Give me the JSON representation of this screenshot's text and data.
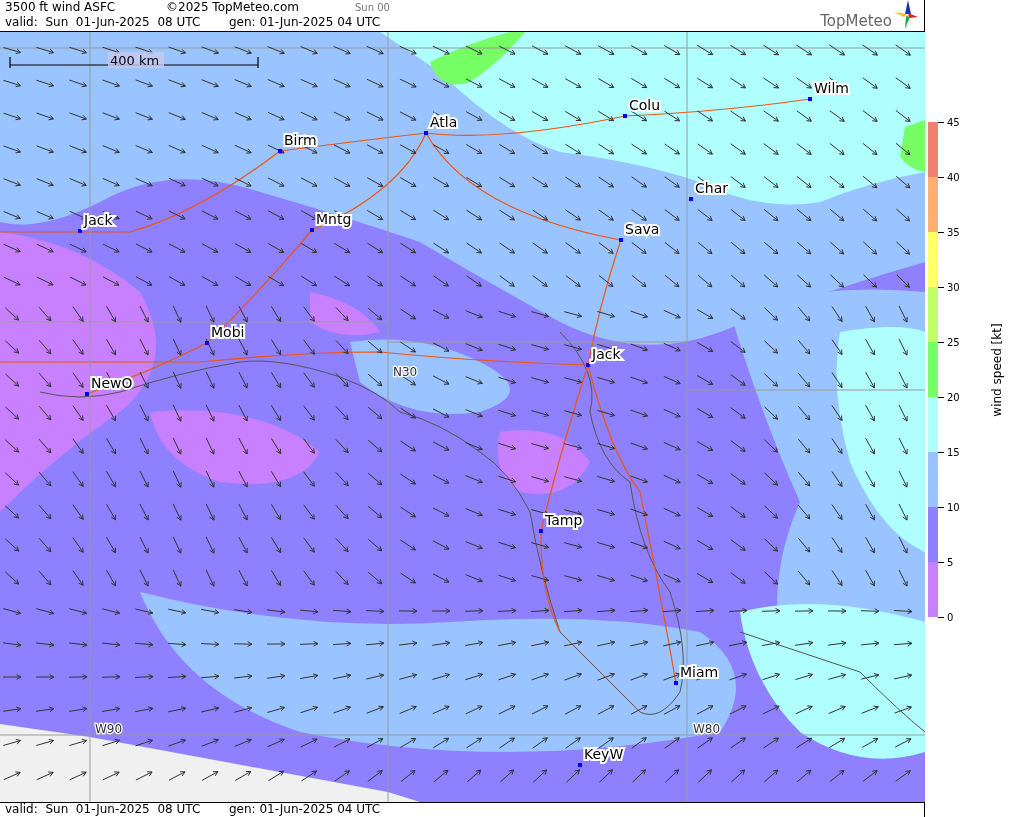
{
  "header": {
    "title": "3500 ft wind ASFC",
    "copyright": "©2025 TopMeteo.com",
    "run": "Sun 00",
    "valid": "valid:  Sun  01-Jun-2025  08 UTC",
    "generated": "gen: 01-Jun-2025 04 UTC",
    "logo": "TopMeteo"
  },
  "map": {
    "scale": "400 km",
    "grid_labels": [
      "N30",
      "W90",
      "W80"
    ],
    "cities": [
      "Wilm",
      "Colu",
      "Atla",
      "Birm",
      "Char",
      "Jack",
      "Mntg",
      "Sava",
      "Mobi",
      "Jack",
      "NewO",
      "Tamp",
      "Miam",
      "KeyW"
    ]
  },
  "footer": {
    "valid": "valid:  Sun  01-Jun-2025  08 UTC",
    "generated": "gen: 01-Jun-2025 04 UTC"
  },
  "legend": {
    "title": "wind speed [kt]",
    "ticks": [
      "45",
      "40",
      "35",
      "30",
      "25",
      "20",
      "15",
      "10",
      "5",
      "0"
    ],
    "bands": [
      {
        "color": "#f08070"
      },
      {
        "color": "#ffb070"
      },
      {
        "color": "#ffff66"
      },
      {
        "color": "#c0ff66"
      },
      {
        "color": "#77ff66"
      },
      {
        "color": "#b0ffff"
      },
      {
        "color": "#99c4ff"
      },
      {
        "color": "#8f80ff"
      },
      {
        "color": "#c880ff"
      }
    ]
  }
}
